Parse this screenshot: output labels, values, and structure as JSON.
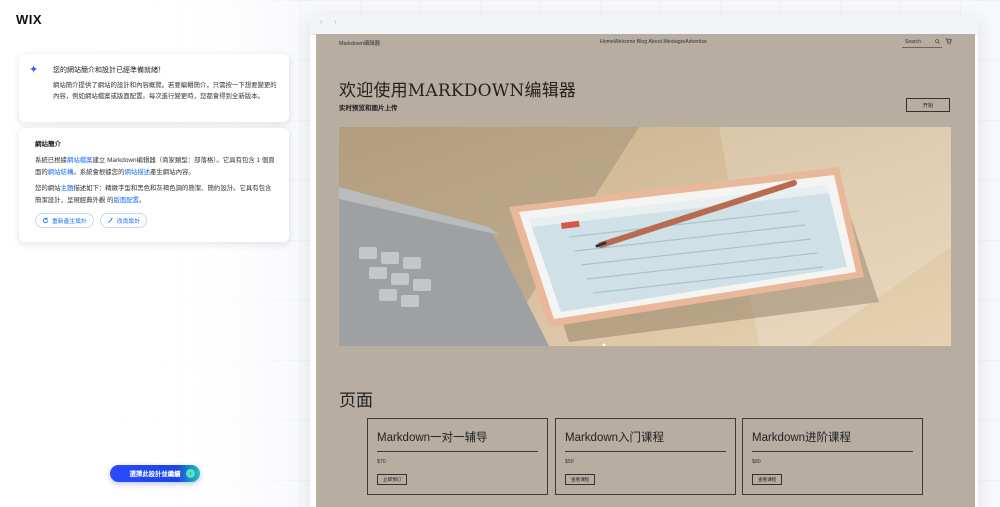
{
  "app": {
    "logo": "WIX"
  },
  "card1": {
    "title": "您的網站簡介和設計已經準備就緒！",
    "body": "網站簡介提供了網站的設計和內容概覽。若要編輯簡介，只需按一下想要變更的內容，例如網站檔案或版面配置。每次進行變更時，您都會得到全新版本。"
  },
  "card2": {
    "title": "網站簡介",
    "p1_a": "系統已根據",
    "p1_link1": "網站檔案",
    "p1_b": "建立 Markdown编辑器（商家類型：部落格）。它具有包含 1 個頁面的",
    "p1_link2": "網站結構",
    "p1_c": "。系統會根據您的",
    "p1_link3": "網站描述",
    "p1_d": "產生網站內容。",
    "p2_a": "您的網站",
    "p2_link1": "主題",
    "p2_b": "描述如下：精緻字型和黑色和灰褐色調的簡潔、簡約設計。它具有包含 簡潔設計，呈現經典外觀 的",
    "p2_link2": "版面配置",
    "p2_c": "。",
    "btn_regen": "重新產生設計",
    "btn_improve": "改良設計"
  },
  "cta": {
    "label": "選擇此設計並繼續"
  },
  "browser": {
    "nav_arrows": "‹ ›"
  },
  "site": {
    "logo": "Markdown编辑器",
    "nav": "HomeWelcome  Blog About MeotagreAdvertise",
    "search_placeholder": "Search",
    "hero_title": "欢迎使用MARKDOWN编辑器",
    "hero_subtitle": "实时预览和图片上传",
    "hero_button": "开始",
    "section_title": "页面",
    "courses": [
      {
        "title": "Markdown一对一辅导",
        "price": "$70",
        "button": "立即预订"
      },
      {
        "title": "Markdown入门课程",
        "price": "$50",
        "button": "查看课程"
      },
      {
        "title": "Markdown进阶课程",
        "price": "$80",
        "button": "查看课程"
      }
    ]
  },
  "colors": {
    "accent": "#116dff",
    "site_bg": "#b7ada1",
    "cta_start": "#2a4bff",
    "cta_end": "#22c3b8"
  },
  "icons": [
    "sparkle-icon",
    "refresh-icon",
    "magic-wand-icon",
    "arrow-right-icon",
    "search-icon",
    "cart-icon"
  ]
}
